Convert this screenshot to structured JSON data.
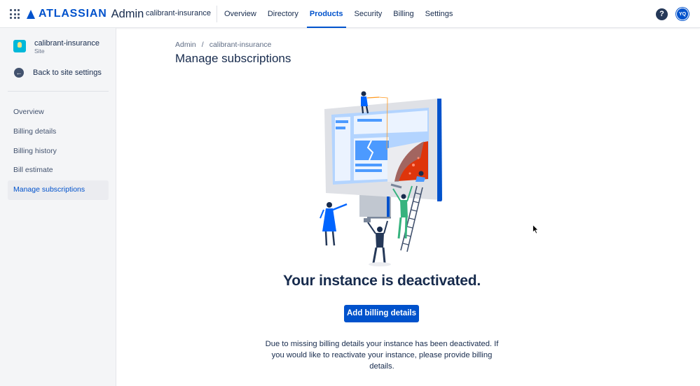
{
  "header": {
    "brand": "ATLASSIAN",
    "product": "Admin",
    "org": "calibrant-insurance",
    "nav": [
      {
        "label": "Overview",
        "active": false
      },
      {
        "label": "Directory",
        "active": false
      },
      {
        "label": "Products",
        "active": true
      },
      {
        "label": "Security",
        "active": false
      },
      {
        "label": "Billing",
        "active": false
      },
      {
        "label": "Settings",
        "active": false
      }
    ],
    "help_label": "?",
    "avatar_initials": "YQ",
    "icons": {
      "apps": "app-switcher-icon",
      "help": "help-icon"
    }
  },
  "sidebar": {
    "site_name": "calibrant-insurance",
    "site_type": "Site",
    "back_label": "Back to site settings",
    "items": [
      {
        "label": "Overview",
        "active": false
      },
      {
        "label": "Billing details",
        "active": false
      },
      {
        "label": "Billing history",
        "active": false
      },
      {
        "label": "Bill estimate",
        "active": false
      },
      {
        "label": "Manage subscriptions",
        "active": true
      }
    ]
  },
  "main": {
    "breadcrumb": [
      "Admin",
      "calibrant-insurance"
    ],
    "title": "Manage subscriptions",
    "headline": "Your instance is deactivated.",
    "cta_label": "Add billing details",
    "description": "Due to missing billing details your instance has been deactivated. If you would like to reactivate your instance, please provide billing details."
  },
  "colors": {
    "brand": "#0052CC",
    "text": "#172B4D",
    "sidebar_bg": "#F4F5F7"
  }
}
